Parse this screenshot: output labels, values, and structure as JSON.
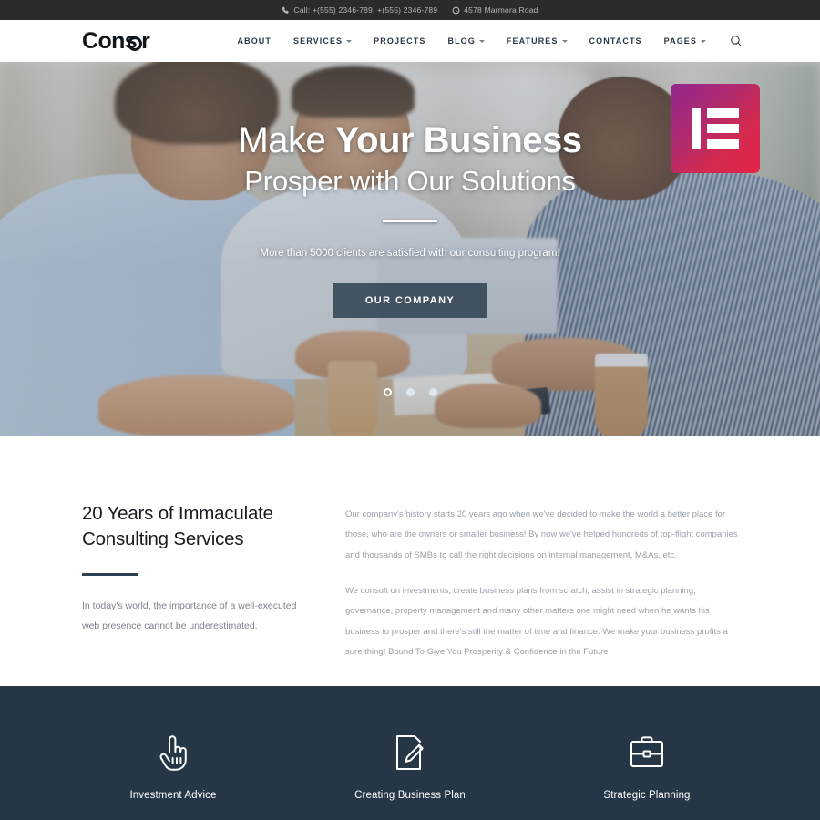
{
  "topbar": {
    "phone_icon": "phone-icon",
    "phone": "Call: +(555) 2346-789, +(555) 2346-789",
    "location_icon": "clock-icon",
    "address": "4578 Marmora Road"
  },
  "header": {
    "logo_before": "Cons",
    "logo_after": "r",
    "nav": [
      {
        "label": "ABOUT",
        "has_caret": false
      },
      {
        "label": "SERVICES",
        "has_caret": true
      },
      {
        "label": "PROJECTS",
        "has_caret": false
      },
      {
        "label": "BLOG",
        "has_caret": true
      },
      {
        "label": "FEATURES",
        "has_caret": true
      },
      {
        "label": "CONTACTS",
        "has_caret": false
      },
      {
        "label": "PAGES",
        "has_caret": true
      }
    ],
    "search_icon": "search-icon"
  },
  "hero": {
    "title_thin": "Make",
    "title_bold": "Your Business",
    "title_line2": "Prosper with Our Solutions",
    "subtitle": "More than 5000 clients are satisfied with our consulting program!",
    "button_label": "OUR COMPANY",
    "slide_count": 3,
    "active_slide": 1,
    "badge": "elementor-logo",
    "overlay_color": "#5c7088",
    "button_color": "#263848"
  },
  "about": {
    "title": "20 Years of Immaculate Consulting Services",
    "left_paragraph": "In today's world, the importance of a well-executed web presence cannot be underestimated.",
    "paragraph_1": "Our company's history starts 20 years ago when we've decided to make the world a better place for those, who are the owners or smaller business! By now we've helped hundreds of top-flight companies and thousands of SMBs to call the right decisions on internal management, M&As, etc.",
    "paragraph_2": "We consult on investments, create business plans from scratch, assist in strategic planning, governance, property management and many other matters one might need when he wants his business to prosper and there's still the matter of time and finance. We make your business profits a sure thing! Bound To Give You Prosperity & Confidence in the Future",
    "accent_color": "#2c4154"
  },
  "services": {
    "background_color": "#253746",
    "items": [
      {
        "label": "Investment Advice",
        "icon": "pointing-hand-icon"
      },
      {
        "label": "Creating Business Plan",
        "icon": "document-pencil-icon"
      },
      {
        "label": "Strategic Planning",
        "icon": "briefcase-icon"
      }
    ]
  }
}
